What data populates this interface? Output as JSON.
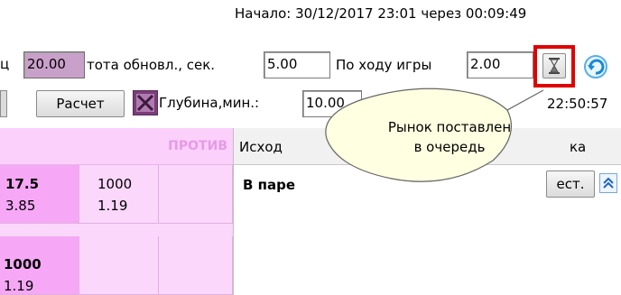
{
  "header": {
    "start_label": "Начало: 30/12/2017 23:01 через 00:09:49"
  },
  "row1": {
    "left_cut_char": "ц",
    "highlight_value": "20.00",
    "refresh_label": "тота обновл., сек.",
    "refresh_value": "5.00",
    "inplay_label": "По ходу игры",
    "inplay_value": "2.00"
  },
  "row2": {
    "calc_button": "Расчет",
    "depth_label": "Глубина,мин.:",
    "depth_value": "10.00",
    "time_cut": "22:50:57"
  },
  "tooltip": {
    "text_line1": "Рынок поставлен",
    "text_line2": "в очередь"
  },
  "left_table": {
    "against_header": "ПРОТИВ",
    "row1": {
      "c1_top": "17.5",
      "c1_bottom": "3.85",
      "c2_top": "1000",
      "c2_bottom": "1.19"
    },
    "row2": {
      "c1_top": "1000",
      "c1_bottom": "1.19"
    }
  },
  "right_panel": {
    "col_outcome": "Исход",
    "col_cut": "ка",
    "row1_label": "В паре",
    "row1_btn": "ест.",
    "collapse_icon": "double-chevron-up-icon"
  },
  "colors": {
    "accent_red": "#e00000",
    "highlight_pink": "#c9a0c9",
    "grid_pink": "#fbd7fb"
  }
}
